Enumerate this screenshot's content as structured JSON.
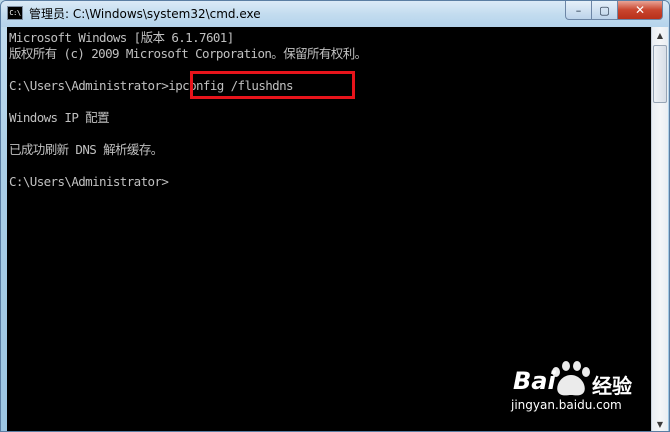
{
  "window": {
    "title": "管理员: C:\\Windows\\system32\\cmd.exe",
    "icon_label": "C:\\",
    "minimize_label": "–",
    "maximize_label": "▢",
    "close_label": "✕"
  },
  "console": {
    "lines": [
      "Microsoft Windows [版本 6.1.7601]",
      "版权所有 (c) 2009 Microsoft Corporation。保留所有权利。",
      "",
      "C:\\Users\\Administrator>ipconfig /flushdns",
      "",
      "Windows IP 配置",
      "",
      "已成功刷新 DNS 解析缓存。",
      "",
      "C:\\Users\\Administrator>"
    ],
    "text_color": "#c0c0c0",
    "background": "#000000",
    "highlighted_command": "ipconfig /flushdns",
    "highlight_color": "#e8141b"
  },
  "scrollbar": {
    "up_label": "▲",
    "down_label": "▼"
  },
  "watermark": {
    "brand": "Bai",
    "brand_suffix": "经验",
    "url": "jingyan.baidu.com"
  }
}
